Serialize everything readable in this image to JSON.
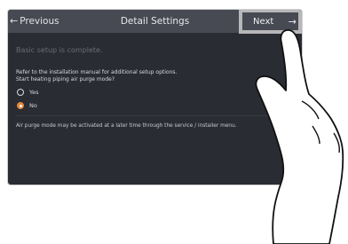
{
  "header": {
    "prev_label": "Previous",
    "title": "Detail Settings",
    "next_label": "Next"
  },
  "content": {
    "setup_complete": "Basic setup is complete.",
    "instruction_line1": "Refer to the installation manual for additional setup options.",
    "instruction_line2": "Start heating piping air purge mode?",
    "options": [
      {
        "label": "Yes",
        "selected": false
      },
      {
        "label": "No",
        "selected": true
      }
    ],
    "note": "Air purge mode may be activated at a later time through the service / installer menu."
  },
  "colors": {
    "accent": "#e28a3a",
    "screen_bg": "#2a2c33",
    "header_bg": "#474a53",
    "highlight": "#b7b7b9"
  },
  "icons": {
    "prev": "arrow-left-icon",
    "next": "arrow-right-icon",
    "pointer": "hand-pointer-icon"
  }
}
